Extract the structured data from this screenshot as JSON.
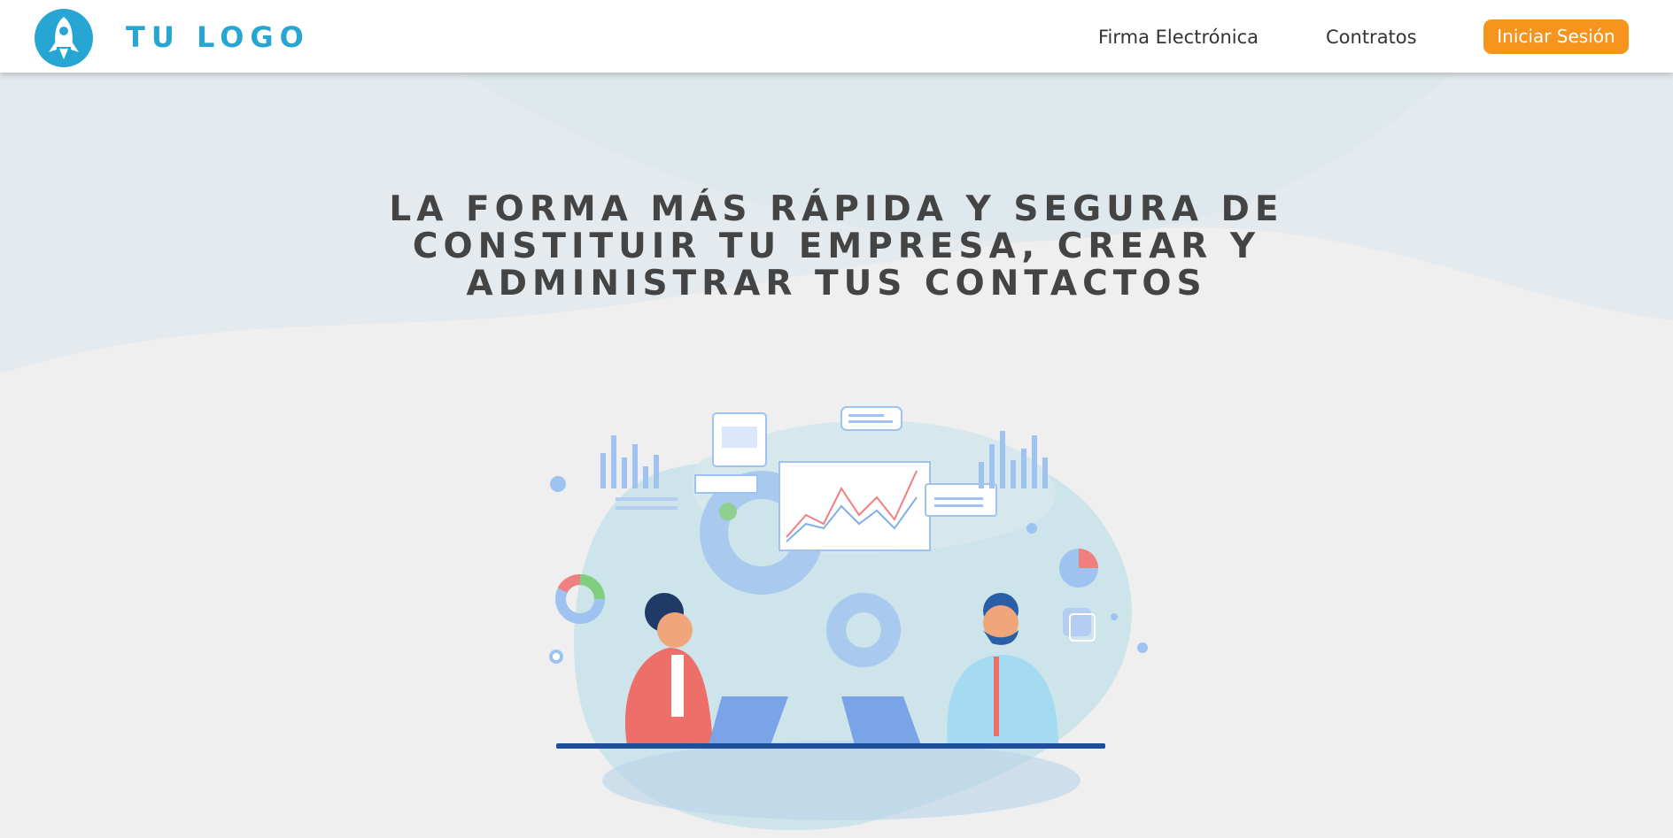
{
  "header": {
    "logo_text": "TU LOGO",
    "nav": {
      "firma": "Firma Electrónica",
      "contratos": "Contratos"
    },
    "login_label": "Iniciar Sesión"
  },
  "hero": {
    "headline": "LA FORMA MÁS RÁPIDA Y SEGURA DE CONSTITUIR TU EMPRESA, CREAR Y ADMINISTRAR TUS CONTACTOS"
  },
  "colors": {
    "brand": "#27a6d3",
    "accent": "#f7941d",
    "headline_text": "#444444",
    "hero_bg": "#efefef"
  },
  "icons": [
    "rocket-logo-icon"
  ]
}
